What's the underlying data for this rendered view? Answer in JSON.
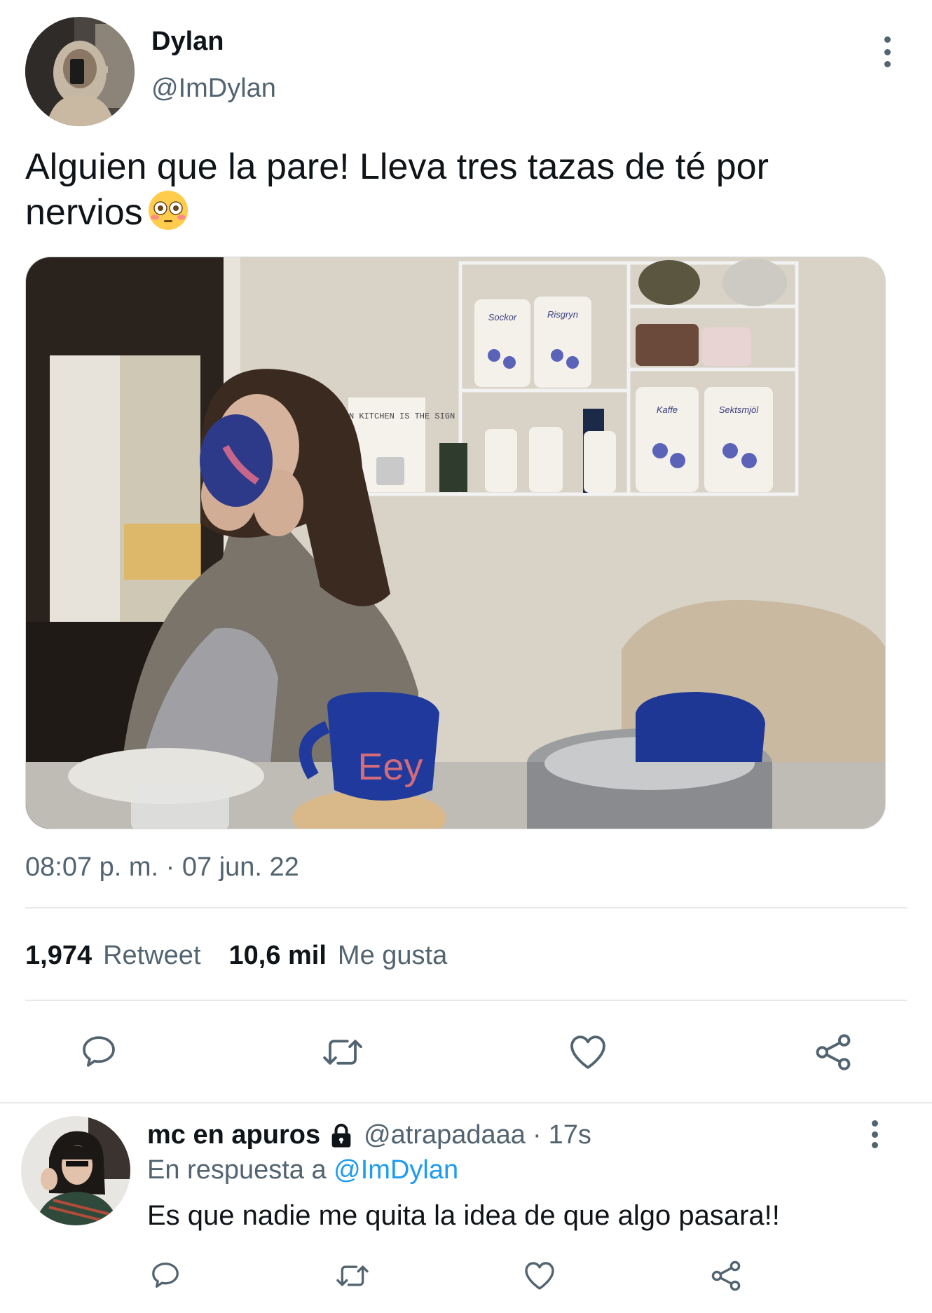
{
  "tweet": {
    "author_name": "Dylan",
    "author_handle": "@ImDylan",
    "text": "Alguien que la pare! Lleva tres tazas de té por nervios",
    "emoji": "flushed-face-emoji",
    "timestamp": "08:07 p. m. · 07 jun. 22",
    "retweets_count": "1,974",
    "retweets_label": "Retweet",
    "likes_count": "10,6 mil",
    "likes_label": "Me gusta",
    "photo_text": {
      "sign": "A CLEAN KITCHEN IS THE SIGN",
      "jar1": "Sockor",
      "jar2": "Risgryn",
      "jar3": "Kaffe",
      "jar4": "Sektsmjöl",
      "mug": "Eey"
    }
  },
  "reply": {
    "author_name": "mc en apuros",
    "author_handle": "@atrapadaaa",
    "separator": "·",
    "time": "17s",
    "reply_prefix": "En respuesta a",
    "reply_to": "@ImDylan",
    "text": "Es que nadie me quita la idea de que algo pasara!!"
  },
  "icons": {
    "reply": "reply-icon",
    "retweet": "retweet-icon",
    "like": "heart-icon",
    "share": "share-icon",
    "more": "more-options-icon",
    "lock": "lock-icon"
  },
  "colors": {
    "text_primary": "#0f1419",
    "text_secondary": "#536471",
    "link": "#1d9bf0",
    "divider": "#e6e9eb"
  }
}
